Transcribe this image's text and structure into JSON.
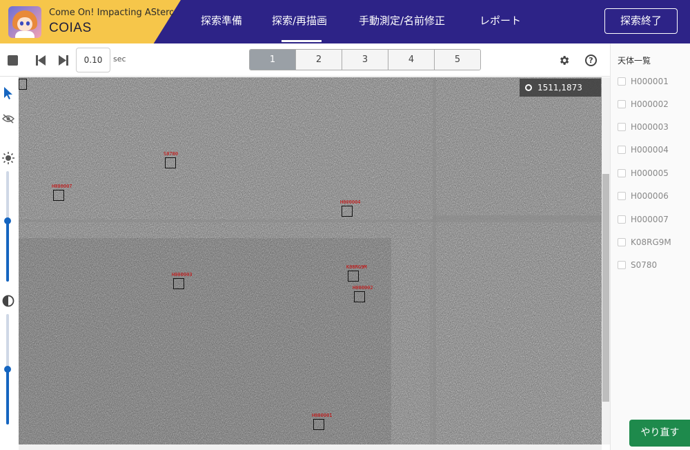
{
  "brand": {
    "subtitle": "Come On! Impacting ASteroids",
    "title": "COIAS"
  },
  "nav": {
    "items": [
      {
        "label": "探索準備"
      },
      {
        "label": "探索/再描画"
      },
      {
        "label": "手動測定/名前修正"
      },
      {
        "label": "レポート"
      }
    ],
    "active": "探索/再描画",
    "end_button": "探索終了"
  },
  "toolbar": {
    "speed_value": "0.10",
    "speed_unit": "sec",
    "pages": [
      "1",
      "2",
      "3",
      "4",
      "5"
    ],
    "active_page": "1",
    "help_glyph": "?"
  },
  "viewer": {
    "coordinate_readout": "1511,1873",
    "markers": [
      {
        "label": "S0780"
      },
      {
        "label": "H000007"
      },
      {
        "label": "H000004"
      },
      {
        "label": "H000003"
      },
      {
        "label": "K08RG9M"
      },
      {
        "label": "H000002"
      },
      {
        "label": "H000001"
      }
    ]
  },
  "objects_panel": {
    "title": "天体一覧",
    "items": [
      "H000001",
      "H000002",
      "H000003",
      "H000004",
      "H000005",
      "H000006",
      "H000007",
      "K08RG9M",
      "S0780"
    ],
    "redo_button": "やり直す"
  },
  "icons": {
    "stop": "stop-icon",
    "prev": "skip-previous-icon",
    "next": "skip-next-icon",
    "settings": "gear-icon",
    "help": "help-circle-icon",
    "pointer": "cursor-arrow-icon",
    "visibility": "eye-off-icon",
    "brightness": "brightness-icon",
    "contrast": "contrast-icon",
    "location": "crosshair-icon"
  },
  "sliders": {
    "brightness_level": 0.55,
    "contrast_level": 0.5
  },
  "colors": {
    "header_bg": "#2d2387",
    "brand_bg": "#f6c64a",
    "accent_blue": "#1565c0",
    "redo_green": "#1e8a4c",
    "marker_label": "#cc0000"
  }
}
